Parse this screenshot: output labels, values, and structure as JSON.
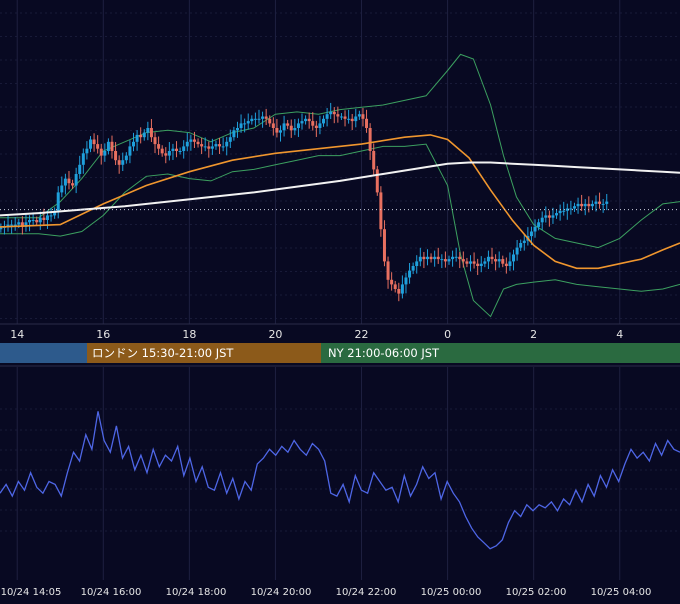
{
  "colors": {
    "background": "#080922",
    "grid": "#1e2040",
    "candle_up": "#1fa0dc",
    "candle_down": "#e87060",
    "ma_fast": "#f0962e",
    "ma_slow": "#f2f2f2",
    "bollinger": "#3ca060",
    "rsi": "#4e66e6",
    "axis_text": "#e6e6e6",
    "session_tokyo": "#2d5a8c",
    "session_london": "#8c5a1a",
    "session_ny": "#2a6a40"
  },
  "sessions": [
    {
      "label": "",
      "color": "#2d5a8c"
    },
    {
      "label": "ロンドン 15:30-21:00 JST",
      "color": "#8c5a1a"
    },
    {
      "label": "NY 21:00-06:00 JST",
      "color": "#2a6a40"
    }
  ],
  "chart_data": [
    {
      "type": "candlestick",
      "x_ticks": [
        "14",
        "16",
        "18",
        "20",
        "22",
        "0",
        "2",
        "4"
      ],
      "x_tick_hours": [
        14,
        16,
        18,
        20,
        22,
        24,
        26,
        28
      ],
      "x_range_hours": [
        13.6,
        29.4
      ],
      "y_range_relative": [
        0,
        1
      ],
      "reference_level": 0.445,
      "grid": true,
      "candles": {
        "start_hour": 13.62,
        "step_hours": 0.0833,
        "close": [
          0.37,
          0.37,
          0.38,
          0.38,
          0.38,
          0.39,
          0.37,
          0.39,
          0.4,
          0.4,
          0.39,
          0.41,
          0.4,
          0.42,
          0.42,
          0.44,
          0.52,
          0.55,
          0.58,
          0.56,
          0.55,
          0.6,
          0.64,
          0.69,
          0.71,
          0.75,
          0.73,
          0.71,
          0.68,
          0.7,
          0.74,
          0.7,
          0.66,
          0.64,
          0.66,
          0.68,
          0.72,
          0.74,
          0.77,
          0.76,
          0.78,
          0.8,
          0.76,
          0.73,
          0.71,
          0.69,
          0.68,
          0.7,
          0.71,
          0.7,
          0.7,
          0.72,
          0.74,
          0.75,
          0.74,
          0.73,
          0.72,
          0.72,
          0.71,
          0.72,
          0.73,
          0.72,
          0.72,
          0.74,
          0.76,
          0.79,
          0.8,
          0.82,
          0.82,
          0.83,
          0.84,
          0.84,
          0.84,
          0.85,
          0.84,
          0.82,
          0.8,
          0.78,
          0.79,
          0.82,
          0.81,
          0.79,
          0.8,
          0.82,
          0.83,
          0.84,
          0.83,
          0.81,
          0.8,
          0.82,
          0.84,
          0.86,
          0.87,
          0.86,
          0.85,
          0.85,
          0.84,
          0.84,
          0.83,
          0.85,
          0.86,
          0.84,
          0.8,
          0.7,
          0.62,
          0.52,
          0.36,
          0.22,
          0.14,
          0.12,
          0.1,
          0.08,
          0.12,
          0.15,
          0.18,
          0.2,
          0.22,
          0.24,
          0.23,
          0.24,
          0.23,
          0.24,
          0.23,
          0.23,
          0.22,
          0.23,
          0.24,
          0.24,
          0.23,
          0.22,
          0.21,
          0.22,
          0.21,
          0.2,
          0.21,
          0.22,
          0.24,
          0.23,
          0.22,
          0.23,
          0.21,
          0.2,
          0.22,
          0.25,
          0.28,
          0.3,
          0.31,
          0.33,
          0.35,
          0.37,
          0.39,
          0.41,
          0.42,
          0.41,
          0.42,
          0.43,
          0.44,
          0.44,
          0.45,
          0.45,
          0.46,
          0.47,
          0.46,
          0.47,
          0.46,
          0.47,
          0.48,
          0.47,
          0.47,
          0.48
        ],
        "up_color": "#1fa0dc",
        "down_color": "#e87060"
      },
      "series": [
        {
          "name": "",
          "kind": "ma_fast",
          "color": "#f0962e",
          "x": [
            13.6,
            15.0,
            16.0,
            17.0,
            18.0,
            19.0,
            20.0,
            21.0,
            22.0,
            23.0,
            23.6,
            24.0,
            24.5,
            25.0,
            25.5,
            26.0,
            26.5,
            27.0,
            27.5,
            28.0,
            28.5,
            29.0,
            29.4
          ],
          "values": [
            0.37,
            0.38,
            0.47,
            0.55,
            0.61,
            0.66,
            0.69,
            0.71,
            0.73,
            0.76,
            0.77,
            0.75,
            0.67,
            0.53,
            0.4,
            0.29,
            0.22,
            0.19,
            0.19,
            0.21,
            0.23,
            0.27,
            0.3
          ]
        },
        {
          "name": "",
          "kind": "ma_slow",
          "color": "#f2f2f2",
          "x": [
            13.6,
            14.5,
            15.5,
            16.5,
            17.5,
            18.5,
            19.5,
            20.5,
            21.5,
            22.5,
            23.5,
            24.0,
            24.5,
            25.0,
            25.5,
            26.0,
            26.5,
            27.0,
            27.5,
            28.0,
            28.5,
            29.0,
            29.4
          ],
          "values": [
            0.42,
            0.43,
            0.445,
            0.46,
            0.48,
            0.5,
            0.52,
            0.545,
            0.57,
            0.6,
            0.63,
            0.645,
            0.65,
            0.65,
            0.645,
            0.64,
            0.635,
            0.63,
            0.625,
            0.62,
            0.615,
            0.61,
            0.605
          ]
        },
        {
          "name": "",
          "kind": "bb_upper",
          "color": "#3ca060",
          "x": [
            13.6,
            14.5,
            15.0,
            15.5,
            16.0,
            16.5,
            17.0,
            17.5,
            18.0,
            18.5,
            19.0,
            19.5,
            20.0,
            20.5,
            21.0,
            21.5,
            22.0,
            22.5,
            23.0,
            23.5,
            24.0,
            24.3,
            24.6,
            25.0,
            25.3,
            25.6,
            26.0,
            26.5,
            27.0,
            27.5,
            28.0,
            28.5,
            29.0,
            29.4
          ],
          "values": [
            0.41,
            0.41,
            0.48,
            0.58,
            0.7,
            0.74,
            0.78,
            0.79,
            0.78,
            0.74,
            0.78,
            0.8,
            0.86,
            0.87,
            0.86,
            0.88,
            0.89,
            0.9,
            0.92,
            0.94,
            1.05,
            1.12,
            1.1,
            0.9,
            0.68,
            0.5,
            0.38,
            0.32,
            0.3,
            0.28,
            0.32,
            0.4,
            0.47,
            0.48
          ]
        },
        {
          "name": "",
          "kind": "bb_lower",
          "color": "#3ca060",
          "x": [
            13.6,
            14.5,
            15.0,
            15.5,
            16.0,
            16.5,
            17.0,
            17.5,
            18.0,
            18.5,
            19.0,
            19.5,
            20.0,
            20.5,
            21.0,
            21.5,
            22.0,
            22.5,
            23.0,
            23.5,
            24.0,
            24.3,
            24.6,
            25.0,
            25.3,
            25.6,
            26.0,
            26.5,
            27.0,
            27.5,
            28.0,
            28.5,
            29.0,
            29.4
          ],
          "values": [
            0.34,
            0.34,
            0.33,
            0.35,
            0.42,
            0.52,
            0.59,
            0.6,
            0.58,
            0.57,
            0.61,
            0.62,
            0.64,
            0.66,
            0.68,
            0.68,
            0.7,
            0.72,
            0.72,
            0.73,
            0.55,
            0.25,
            0.05,
            -0.02,
            0.1,
            0.12,
            0.13,
            0.14,
            0.12,
            0.11,
            0.1,
            0.09,
            0.1,
            0.12
          ]
        }
      ]
    },
    {
      "type": "line",
      "series": [
        {
          "name": "",
          "color": "#4e66e6",
          "x_range_hours": [
            13.6,
            29.4
          ],
          "values": [
            48,
            51,
            47,
            52,
            49,
            55,
            50,
            48,
            52,
            51,
            47,
            55,
            62,
            59,
            68,
            63,
            76,
            66,
            62,
            71,
            60,
            64,
            56,
            61,
            55,
            63,
            57,
            61,
            59,
            64,
            54,
            60,
            52,
            57,
            50,
            49,
            55,
            48,
            53,
            46,
            52,
            49,
            58,
            60,
            63,
            61,
            64,
            62,
            66,
            63,
            61,
            65,
            63,
            59,
            48,
            47,
            51,
            45,
            54,
            49,
            48,
            55,
            52,
            49,
            50,
            45,
            54,
            47,
            51,
            57,
            53,
            55,
            46,
            52,
            48,
            45,
            40,
            36,
            33,
            31,
            29,
            30,
            32,
            38,
            42,
            40,
            44,
            42,
            44,
            43,
            45,
            42,
            46,
            44,
            49,
            45,
            51,
            47,
            54,
            50,
            56,
            52,
            58,
            63,
            60,
            62,
            59,
            65,
            61,
            66,
            63,
            62
          ]
        }
      ],
      "ylim": [
        20,
        85
      ],
      "grid": true
    }
  ],
  "x_axis_labels": [
    "10/24 14:05",
    "10/24 16:00",
    "10/24 18:00",
    "10/24 20:00",
    "10/24 22:00",
    "10/25 00:00",
    "10/25 02:00",
    "10/25 04:00"
  ]
}
